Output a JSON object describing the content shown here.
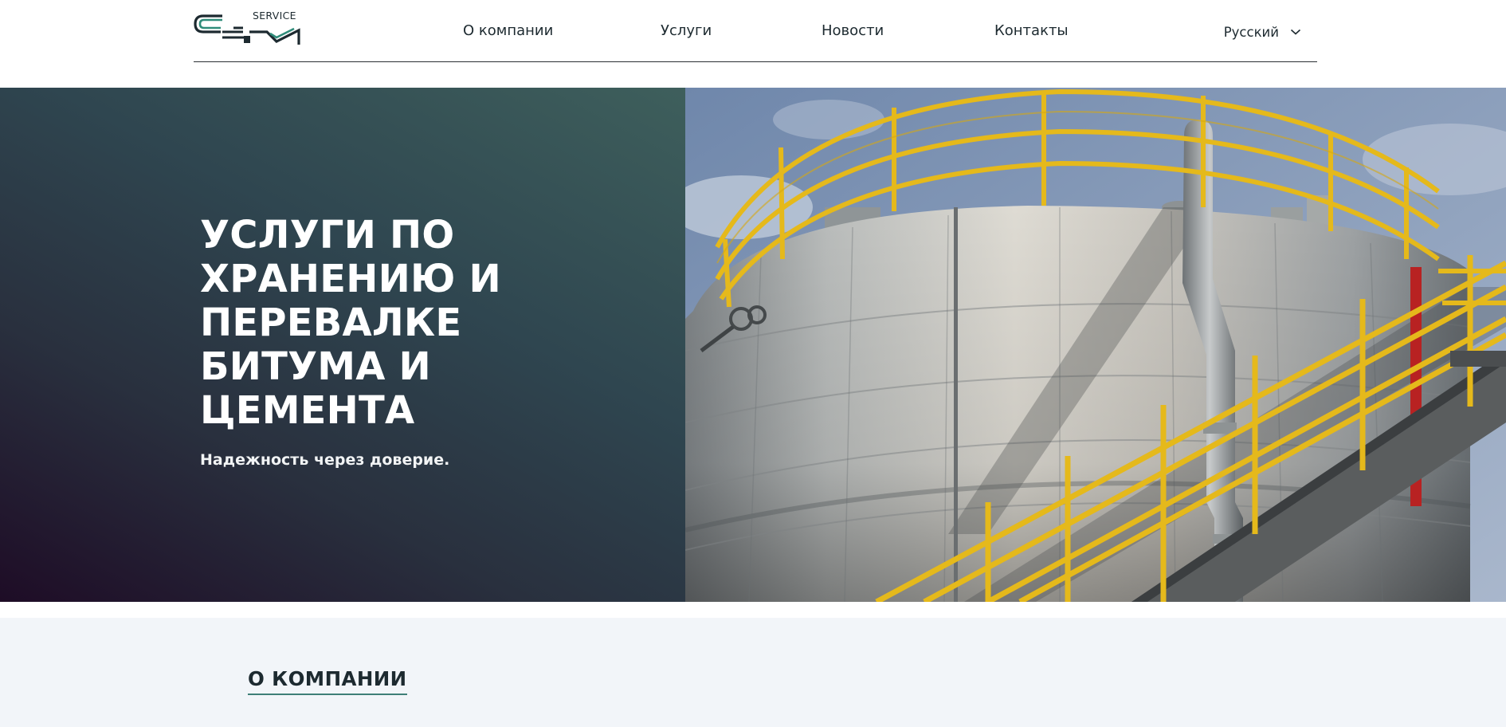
{
  "brand": {
    "logo_text": "CEM",
    "logo_caption": "SERVICE",
    "colors": {
      "logo_dark": "#1d2a30",
      "logo_green": "#2f8c7a"
    }
  },
  "nav": {
    "items": [
      {
        "label": "О компании"
      },
      {
        "label": "Услуги"
      },
      {
        "label": "Новости"
      },
      {
        "label": "Контакты"
      }
    ],
    "language": {
      "selected": "Русский",
      "icon": "chevron-down-icon"
    }
  },
  "hero": {
    "title": "Услуги по хранению и перевалке битума и цемента",
    "subtitle": "Надежность через доверие.",
    "image": "industrial-storage-tank-photo",
    "colors": {
      "gradient_start": "#1e0c26",
      "gradient_end": "#3e5f5c",
      "railing": "#e5b91b",
      "sky": "#7c93b4"
    }
  },
  "about": {
    "title": "О компании",
    "accent": "#3e7f78",
    "background": "#f2f5f9"
  }
}
